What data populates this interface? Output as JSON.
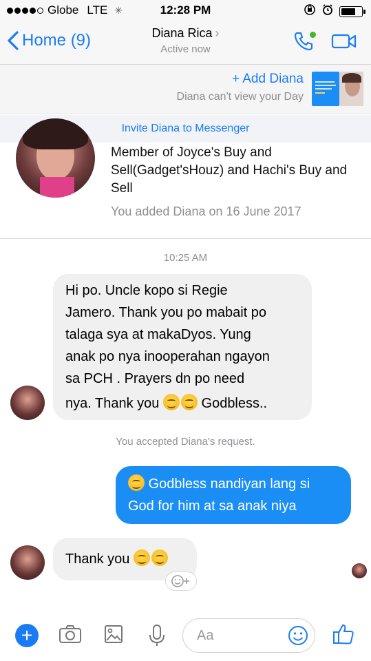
{
  "status_bar": {
    "carrier": "Globe",
    "network": "LTE",
    "time": "12:28 PM",
    "battery_level": 0.75
  },
  "nav": {
    "back_label": "Home (9)",
    "contact_name": "Diana Rica",
    "presence": "Active now",
    "icons": [
      "phone-icon",
      "video-call-icon"
    ]
  },
  "day_banner": {
    "add_label": "+ Add Diana",
    "subtext": "Diana can't view your Day"
  },
  "invite": {
    "label": "Invite Diana to Messenger"
  },
  "profile": {
    "description": "Member of Joyce's Buy and Sell(Gadget'sHouz) and Hachi's Buy and Sell",
    "added": "You added Diana on 16 June 2017"
  },
  "messages": {
    "timestamp": "10:25 AM",
    "msg1_lines": [
      "Hi po. Uncle kopo si Regie",
      "Jamero. Thank you po mabait po",
      "talaga sya at makaDyos. Yung",
      "anak po nya inooperahan ngayon",
      "sa PCH . Prayers dn po need"
    ],
    "msg1_last_a": "nya. Thank you ",
    "msg1_last_b": " Godbless..",
    "system": "You accepted Diana's request.",
    "msg2_line1": " Godbless nandiyan lang si",
    "msg2_line2": "God for him at sa anak niya",
    "msg3": "Thank you "
  },
  "composer": {
    "placeholder": "Aa",
    "accent": "#1a7cf4"
  }
}
